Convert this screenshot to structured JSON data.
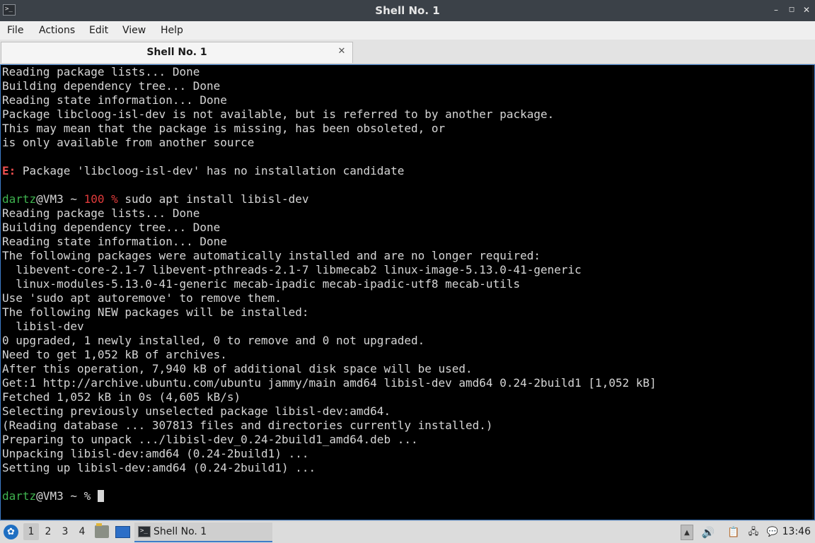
{
  "window": {
    "title": "Shell No. 1",
    "icon": "terminal-icon"
  },
  "menu": {
    "items": [
      {
        "label": "File"
      },
      {
        "label": "Actions"
      },
      {
        "label": "Edit"
      },
      {
        "label": "View"
      },
      {
        "label": "Help"
      }
    ]
  },
  "tabs": [
    {
      "label": "Shell No. 1",
      "close_icon": "close-icon"
    }
  ],
  "terminal": {
    "prompt": {
      "user": "dartz",
      "host": "@VM3",
      "dir": " ~ ",
      "status": "100 % ",
      "symbol": "% "
    },
    "lines": [
      "Reading package lists... Done",
      "Building dependency tree... Done",
      "Reading state information... Done",
      "Package libcloog-isl-dev is not available, but is referred to by another package.",
      "This may mean that the package is missing, has been obsoleted, or",
      "is only available from another source",
      "",
      {
        "err_prefix": "E:",
        "text": " Package 'libcloog-isl-dev' has no installation candidate"
      },
      "",
      {
        "prompt_cmd": "sudo apt install libisl-dev"
      },
      "Reading package lists... Done",
      "Building dependency tree... Done",
      "Reading state information... Done",
      "The following packages were automatically installed and are no longer required:",
      "  libevent-core-2.1-7 libevent-pthreads-2.1-7 libmecab2 linux-image-5.13.0-41-generic",
      "  linux-modules-5.13.0-41-generic mecab-ipadic mecab-ipadic-utf8 mecab-utils",
      "Use 'sudo apt autoremove' to remove them.",
      "The following NEW packages will be installed:",
      "  libisl-dev",
      "0 upgraded, 1 newly installed, 0 to remove and 0 not upgraded.",
      "Need to get 1,052 kB of archives.",
      "After this operation, 7,940 kB of additional disk space will be used.",
      "Get:1 http://archive.ubuntu.com/ubuntu jammy/main amd64 libisl-dev amd64 0.24-2build1 [1,052 kB]",
      "Fetched 1,052 kB in 0s (4,605 kB/s)",
      "Selecting previously unselected package libisl-dev:amd64.",
      "(Reading database ... 307813 files and directories currently installed.)",
      "Preparing to unpack .../libisl-dev_0.24-2build1_amd64.deb ...",
      "Unpacking libisl-dev:amd64 (0.24-2build1) ...",
      "Setting up libisl-dev:amd64 (0.24-2build1) ...",
      "",
      {
        "final_prompt": true
      }
    ],
    "colors": {
      "user": "#3fb34f",
      "status": "#e03b3b",
      "error": "#f05050",
      "text": "#d6d6d6",
      "background": "#000000"
    }
  },
  "taskbar": {
    "start_icon": "lxqt-start-icon",
    "desktops": [
      "1",
      "2",
      "3",
      "4"
    ],
    "active_desktop": "1",
    "quicklaunch": [
      "file-manager-icon",
      "show-desktop-icon"
    ],
    "task": {
      "label": "Shell No. 1",
      "icon": "terminal-icon"
    },
    "tray": [
      "tray-up-arrow-icon",
      "volume-icon",
      "clipboard-icon",
      "network-icon",
      "notification-icon"
    ],
    "clock": "13:46",
    "accent": "#3d7cc9"
  }
}
